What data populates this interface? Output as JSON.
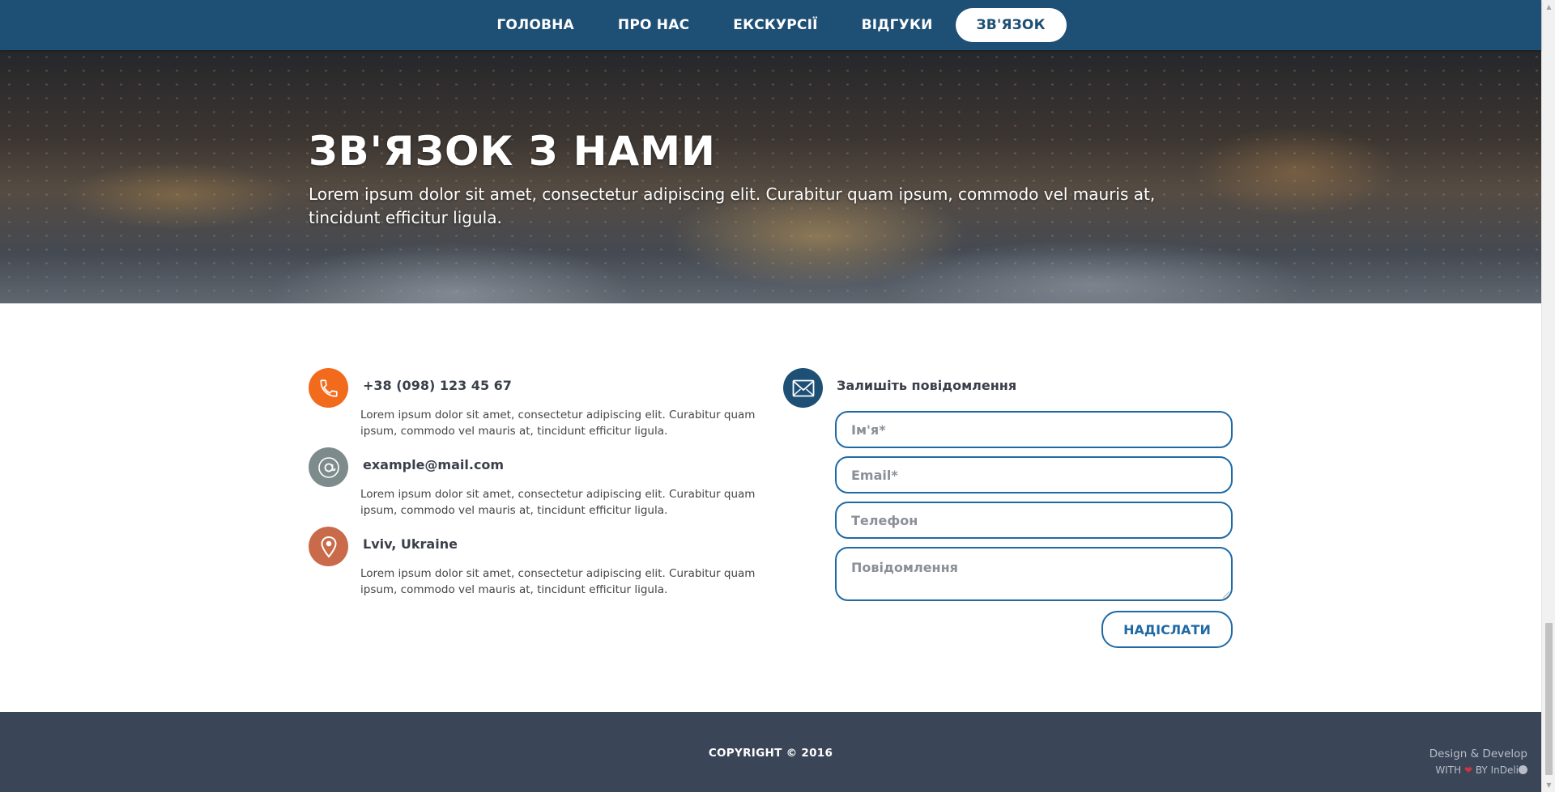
{
  "nav": {
    "items": [
      {
        "label": "ГОЛОВНА",
        "active": false
      },
      {
        "label": "ПРО НАС",
        "active": false
      },
      {
        "label": "ЕКСКУРСІЇ",
        "active": false
      },
      {
        "label": "ВІДГУКИ",
        "active": false
      },
      {
        "label": "ЗВ'ЯЗОК",
        "active": true
      }
    ]
  },
  "hero": {
    "title": "ЗВ'ЯЗОК З НАМИ",
    "text": "Lorem ipsum dolor sit amet, consectetur adipiscing elit. Curabitur quam ipsum, commodo vel mauris at, tincidunt efficitur ligula."
  },
  "contacts": [
    {
      "icon": "phone-icon",
      "color": "#f26b1d",
      "title": "+38 (098) 123 45 67",
      "text": "Lorem ipsum dolor sit amet, consectetur adipiscing elit. Curabitur quam ipsum, commodo vel mauris at, tincidunt efficitur ligula."
    },
    {
      "icon": "at-sign-icon",
      "color": "#7e8b8c",
      "title": "example@mail.com",
      "text": "Lorem ipsum dolor sit amet, consectetur adipiscing elit. Curabitur quam ipsum, commodo vel mauris at, tincidunt efficitur ligula."
    },
    {
      "icon": "map-pin-icon",
      "color": "#c96b4a",
      "title": "Lviv, Ukraine",
      "text": "Lorem ipsum dolor sit amet, consectetur adipiscing elit. Curabitur quam ipsum, commodo vel mauris at, tincidunt efficitur ligula."
    }
  ],
  "form": {
    "heading": "Залишіть повідомлення",
    "name_placeholder": "Ім'я*",
    "email_placeholder": "Email*",
    "phone_placeholder": "Телефон",
    "message_placeholder": "Повідомлення",
    "submit_label": "НАДІСЛАТИ"
  },
  "footer": {
    "copyright": "COPYRIGHT © 2016",
    "credit_line1": "Design & Develop",
    "credit_with": "WITH",
    "credit_by": "BY InDeli"
  },
  "colors": {
    "nav_bg": "#1e4f74",
    "accent": "#1f6aa5",
    "footer_bg": "#3a4558"
  }
}
